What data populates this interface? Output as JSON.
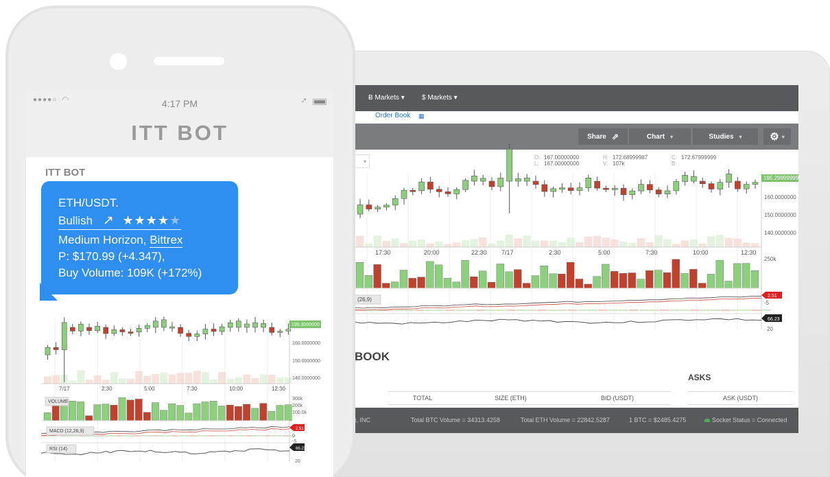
{
  "tablet": {
    "nav": {
      "btc_markets": "Ƀ Markets ▾",
      "usd_markets": "$ Markets ▾"
    },
    "order_book_link": "Order Book",
    "toolbar": {
      "share": "Share",
      "chart": "Chart",
      "studies": "Studies"
    },
    "ohlc": {
      "o_label": "O:",
      "o": "167.00000000",
      "l_label": "L:",
      "l": "167.00000000",
      "h_label": "H:",
      "h": "172.68999987",
      "v_label": "V:",
      "v": "107k",
      "c_label": "C:",
      "c": "172.67999999",
      "b_label": "B:"
    },
    "price_axis": [
      "160.0000000",
      "150.0000000",
      "140.0000000"
    ],
    "last_price_tag": "195.29999999",
    "time_axis": [
      "17:30",
      "20:00",
      "22:30",
      "7/17",
      "2:30",
      "5:00",
      "7:30",
      "10:00",
      "12:30"
    ],
    "volume_axis": [
      "250k"
    ],
    "macd_label": "(26,9)",
    "macd_tag": "2.51",
    "macd_axis": [
      "-5"
    ],
    "rsi_tag": "66.23",
    "rsi_axis": [
      "20"
    ],
    "order_book_title": "BOOK",
    "asks_title": "ASKS",
    "table_headers": [
      "TOTAL",
      "SIZE (ETH)",
      "BID (USDT)",
      "ASK (USDT)"
    ],
    "status": {
      "company": "t, INC",
      "btc_volume": "Total BTC Volume = 34313.4258",
      "eth_volume": "Total ETH Volume = 22842.5287",
      "rate": "1 BTC = $2485.4275",
      "socket": "Socket Status = Connected"
    }
  },
  "phone": {
    "time": "4:17 PM",
    "app_title": "ITT BOT",
    "sender": "ITT BOT",
    "message": {
      "pair": "ETH/USDT.",
      "trend": "Bullish",
      "rating": 4,
      "rating_max": 5,
      "horizon": "Medium Horizon, ",
      "exchange": "Bittrex",
      "price": "P: $170.99 (+4.347),",
      "volume": "Buy Volume: 109K (+172%)"
    },
    "chart": {
      "last_price_tag": "195.3000000",
      "price_axis": [
        "160.0000000",
        "150.0000000",
        "140.0000000"
      ],
      "time_axis": [
        "7/17",
        "2:30",
        "5:00",
        "7:30",
        "10:00",
        "12:30"
      ],
      "volume_label": "VOLUME",
      "volume_axis": [
        "300k",
        "200k",
        "100.0k"
      ],
      "macd_label": "MACD (12,26,9)",
      "macd_tag": "2.51",
      "macd_axis": [
        "0",
        "-5"
      ],
      "rsi_label": "RSI (14)",
      "rsi_tag": "66.23",
      "rsi_axis": [
        "20"
      ]
    }
  },
  "colors": {
    "bull": "#8ccf7c",
    "bear": "#c2412d",
    "bubble": "#2f8ff0",
    "nav": "#57595d",
    "last_tag": "#7dc36b",
    "alert": "#e02020"
  }
}
